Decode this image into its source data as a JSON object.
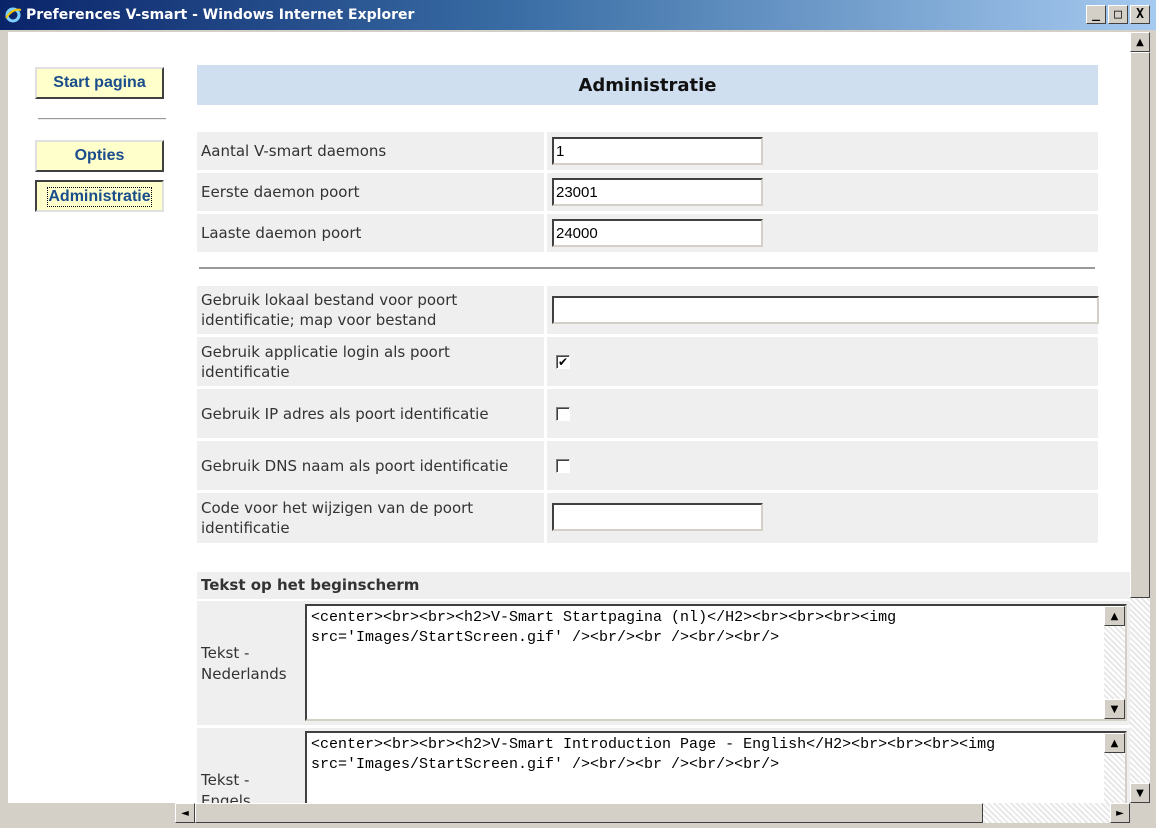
{
  "window": {
    "title": "Preferences V-smart - Windows Internet Explorer",
    "minimize": "_",
    "maximize": "□",
    "close": "X"
  },
  "nav": {
    "start": "Start pagina",
    "opties": "Opties",
    "administratie": "Administratie"
  },
  "header": {
    "title": "Administratie"
  },
  "fields": {
    "daemons": {
      "label": "Aantal V-smart daemons",
      "value": "1"
    },
    "first_port": {
      "label": "Eerste daemon poort",
      "value": "23001"
    },
    "last_port": {
      "label": "Laaste daemon poort",
      "value": "24000"
    },
    "local_file": {
      "label": "Gebruik lokaal bestand voor poort identificatie; map voor bestand",
      "value": ""
    },
    "app_login": {
      "label": "Gebruik applicatie login als poort identificatie",
      "checked": true,
      "mark": "✔"
    },
    "ip_address": {
      "label": "Gebruik IP adres als poort identificatie",
      "checked": false
    },
    "dns_name": {
      "label": "Gebruik DNS naam als poort identificatie",
      "checked": false
    },
    "change_code": {
      "label": "Code voor het wijzigen van de poort identificatie",
      "value": ""
    }
  },
  "start_text": {
    "section_title": "Tekst op het beginscherm",
    "nl": {
      "label": "Tekst - Nederlands",
      "value": "<center><br><br><h2>V-Smart Startpagina (nl)</H2><br><br><br><img src='Images/StartScreen.gif' /><br/><br /><br/><br/>"
    },
    "en": {
      "label": "Tekst - Engels",
      "value": "<center><br><br><h2>V-Smart Introduction Page - English</H2><br><br><br><img src='Images/StartScreen.gif' /><br/><br /><br/><br/>"
    }
  },
  "scroll": {
    "up": "▲",
    "down": "▼",
    "left": "◄",
    "right": "►"
  },
  "colors": {
    "titlebar": "#0a246a",
    "header_bg": "#cfdff0",
    "nav_bg": "#ffffcc",
    "nav_text": "#1a4d8c",
    "row_bg": "#efefef"
  }
}
